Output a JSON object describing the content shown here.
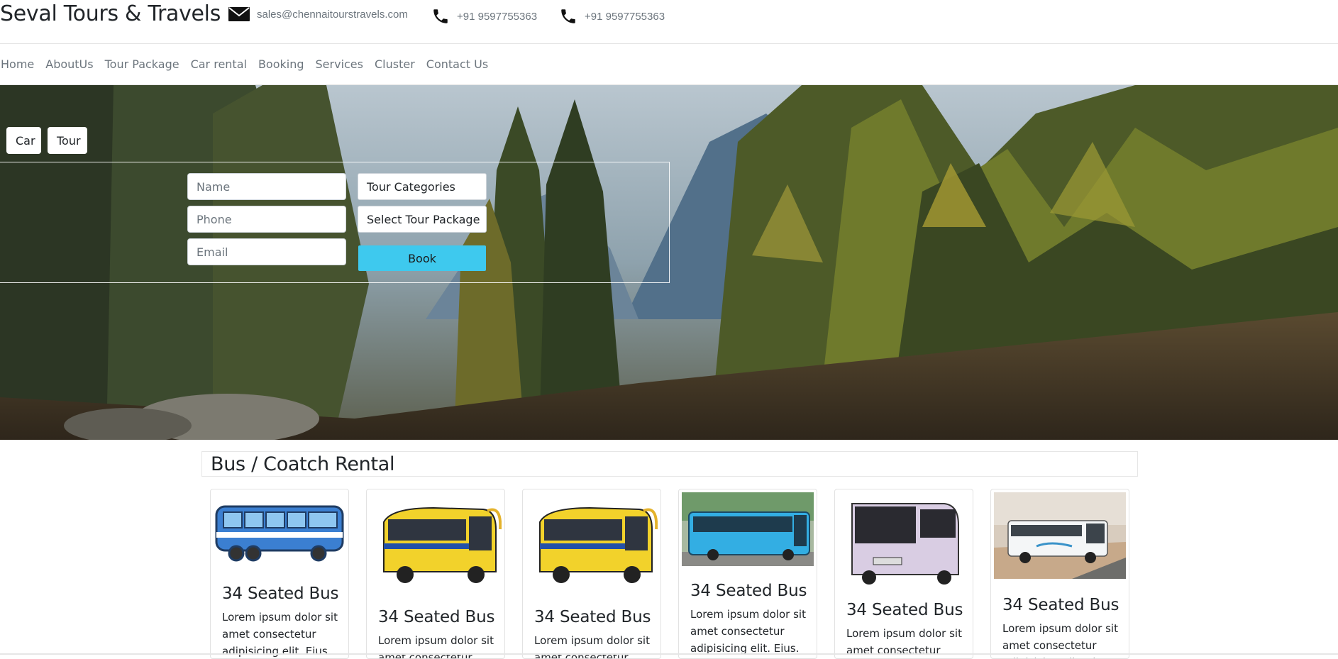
{
  "header": {
    "brand": "Seval Tours & Travels",
    "email": "sales@chennaitourstravels.com",
    "phone1": "+91 9597755363",
    "phone2": "+91 9597755363"
  },
  "nav": {
    "items": [
      "Home",
      "AboutUs",
      "Tour Package",
      "Car rental",
      "Booking",
      "Services",
      "Cluster",
      "Contact Us"
    ]
  },
  "booking": {
    "tabs": [
      "Car",
      "Tour"
    ],
    "name_placeholder": "Name",
    "phone_placeholder": "Phone",
    "email_placeholder": "Email",
    "tour_categories": "Tour Categories",
    "tour_package": "Select Tour Package",
    "book_label": "Book",
    "accent_color": "#3ec9ee"
  },
  "section": {
    "title": "Bus / Coatch Rental",
    "cards": [
      {
        "title": "34 Seated Bus",
        "text": "Lorem ipsum dolor sit amet consectetur adipisicing elit. Eius.",
        "icon": "blue-cartoon-bus-image"
      },
      {
        "title": "34 Seated Bus",
        "text": "Lorem ipsum dolor sit amet consectetur adipisicing elit. Eius.",
        "icon": "yellow-school-bus-image"
      },
      {
        "title": "34 Seated Bus",
        "text": "Lorem ipsum dolor sit amet consectetur adipisicing elit. Eius.",
        "icon": "yellow-school-bus-image"
      },
      {
        "title": "34 Seated Bus",
        "text": "Lorem ipsum dolor sit amet consectetur adipisicing elit. Eius.",
        "icon": "blue-city-bus-image"
      },
      {
        "title": "34 Seated Bus",
        "text": "Lorem ipsum dolor sit amet consectetur adipisicing elit. Eius.",
        "icon": "lilac-coach-bus-image"
      },
      {
        "title": "34 Seated Bus",
        "text": "Lorem ipsum dolor sit amet consectetur adipisicing elit. Eius.",
        "icon": "white-coach-bus-image"
      }
    ]
  }
}
